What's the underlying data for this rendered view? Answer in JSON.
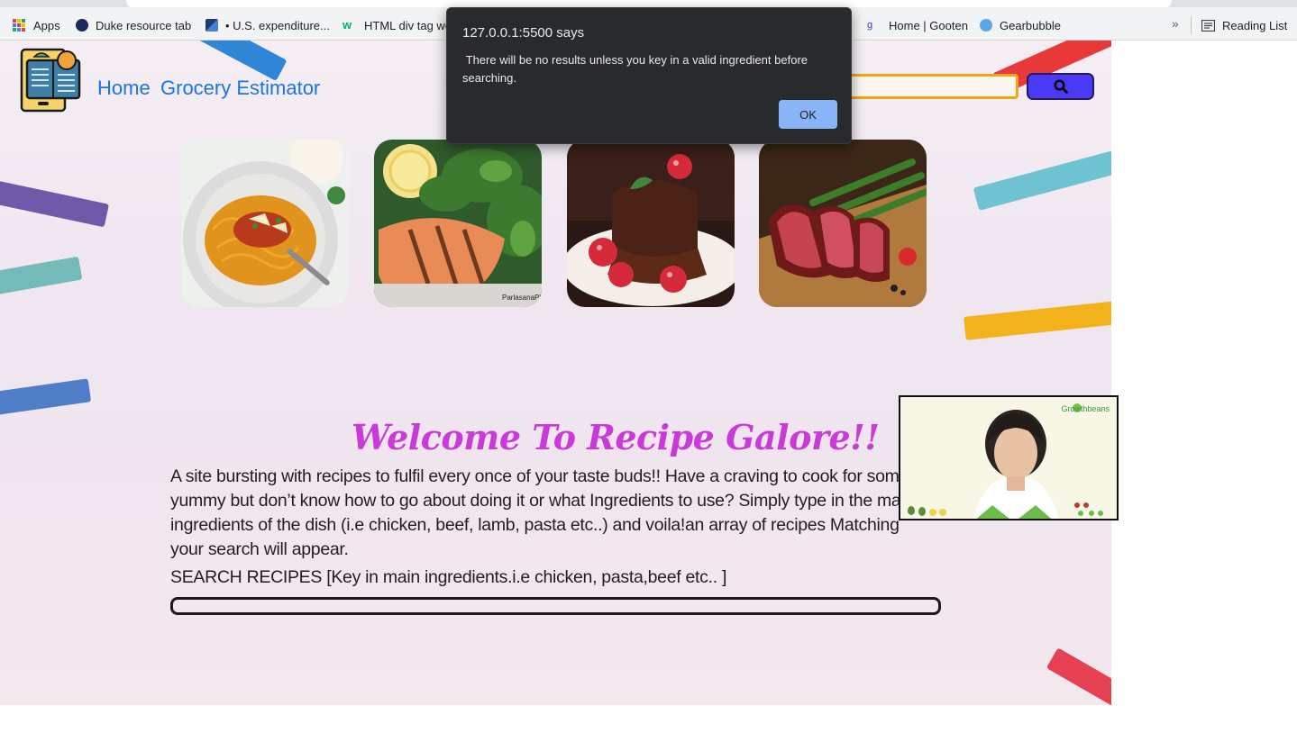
{
  "browser": {
    "bookmarks": [
      {
        "label": "Apps",
        "icon": "apps-grid-icon"
      },
      {
        "label": "Duke resource tab",
        "icon": "duke-logo-icon"
      },
      {
        "label": "• U.S. expenditure...",
        "icon": "chart-bookmark-icon"
      },
      {
        "label": "HTML div tag wo",
        "icon": "w3schools-icon"
      },
      {
        "label": "Home | Gooten",
        "icon": "gooten-icon"
      },
      {
        "label": "Gearbubble",
        "icon": "gearbubble-icon"
      }
    ],
    "overflow_label": "»",
    "reading_list_label": "Reading List"
  },
  "site": {
    "nav": {
      "home": "Home",
      "grocery": "Grocery Estimator"
    },
    "welcome_title": "Welcome To Recipe Galore!!",
    "intro_text": "A site bursting with recipes to fulfil every once of your taste buds!! Have a craving to cook for some yummy but don’t know how to go about doing it or what Ingredients to use? Simply type in the main ingredients of the dish (i.e chicken, beef, lamb, pasta etc..) and voila!an array of recipes Matching your search will appear.",
    "search_label": "SEARCH RECIPES [Key in main ingredients.i.e chicken, pasta,beef etc.. ]",
    "food_images": [
      "spaghetti-bolognese",
      "grilled-salmon-with-greens",
      "chocolate-lava-cake-with-raspberries",
      "sliced-steak-with-asparagus"
    ],
    "food_watermark": "ParlasanaPl",
    "accent_colors": {
      "title": "#c83bd6",
      "link": "#1a73e8",
      "search_button": "#4b3af5",
      "search_border": "#f2a417"
    }
  },
  "alert": {
    "origin": "127.0.0.1:5500 says",
    "message": " There will be no results unless you key in a valid ingredient before searching.",
    "ok_label": "OK"
  },
  "video_overlay": {
    "brand": "Growthbeans"
  }
}
